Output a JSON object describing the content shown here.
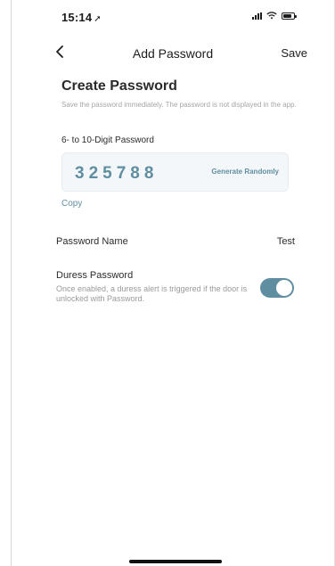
{
  "status_bar": {
    "time": "15:14",
    "location_arrow": "➚",
    "icons": [
      "signal-icon",
      "wifi-icon",
      "battery-icon"
    ]
  },
  "nav": {
    "back_icon": "chevron-left-icon",
    "title": "Add Password",
    "save_label": "Save"
  },
  "create": {
    "title": "Create Password",
    "description": "Save the password immediately. The password is not displayed in the app.",
    "field_label": "6- to 10-Digit Password",
    "password_value": "325788",
    "generate_label": "Generate Randomly",
    "copy_label": "Copy"
  },
  "name_row": {
    "label": "Password Name",
    "value": "Test"
  },
  "duress": {
    "title": "Duress Password",
    "description": "Once enabled, a duress alert is triggered if the door is unlocked with Password.",
    "enabled": true
  },
  "colors": {
    "accent": "#5f8ea1",
    "input_bg": "#f3f7f9",
    "text": "#2b2b2b",
    "muted": "#a6a6a6"
  }
}
